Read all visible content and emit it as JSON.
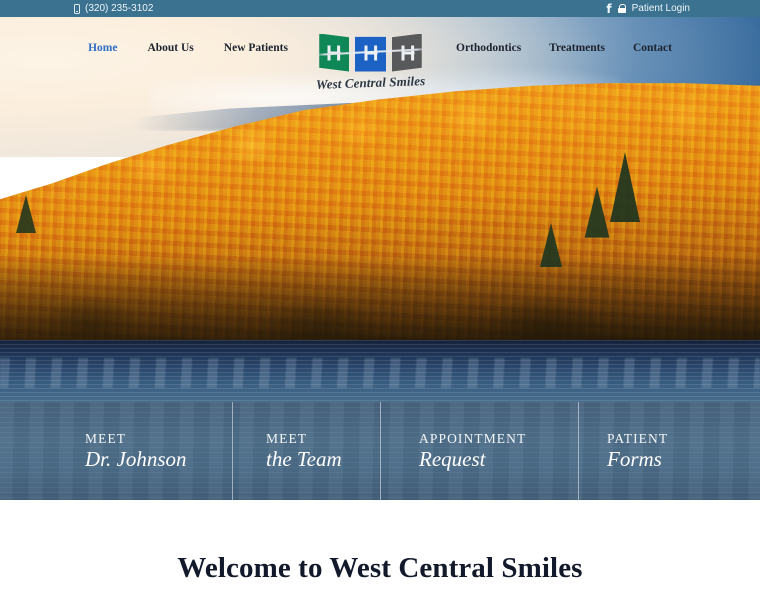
{
  "topbar": {
    "phone_icon": "mobile-phone-icon",
    "phone": "(320) 235-3102",
    "facebook_icon": "facebook-icon",
    "facebook_glyph": "f",
    "lock_icon": "lock-icon",
    "patient_login": "Patient Login"
  },
  "nav": {
    "left": [
      {
        "label": "Home",
        "active": true
      },
      {
        "label": "About Us",
        "active": false
      },
      {
        "label": "New Patients",
        "active": false
      }
    ],
    "right": [
      {
        "label": "Orthodontics",
        "active": false
      },
      {
        "label": "Treatments",
        "active": false
      },
      {
        "label": "Contact",
        "active": false
      }
    ]
  },
  "logo": {
    "name": "West Central Smiles",
    "panel_colors": [
      "#0f8757",
      "#1b62c4",
      "#58595b"
    ],
    "icon": "braces-tooth-logo-icon"
  },
  "hero": {
    "image_description": "Autumn forest of orange and gold trees on a hillside above a blue lake, cream and blue sky above",
    "colors": {
      "sky_left": "#f7efe2",
      "sky_right": "#36699b",
      "foliage": "#e8951f",
      "lake": "#2b4a6e"
    }
  },
  "cta": {
    "items": [
      {
        "line1": "MEET",
        "line2": "Dr. Johnson"
      },
      {
        "line1": "MEET",
        "line2": "the Team"
      },
      {
        "line1": "APPOINTMENT",
        "line2": "Request"
      },
      {
        "line1": "PATIENT",
        "line2": "Forms"
      }
    ],
    "background_color": "#4a6a86"
  },
  "welcome": {
    "title": "Welcome to West Central Smiles",
    "rule_color": "#aebdd4"
  },
  "theme": {
    "topbar_color": "#3a7290",
    "accent_blue": "#2f6fc4",
    "heading_color": "#12192b"
  }
}
